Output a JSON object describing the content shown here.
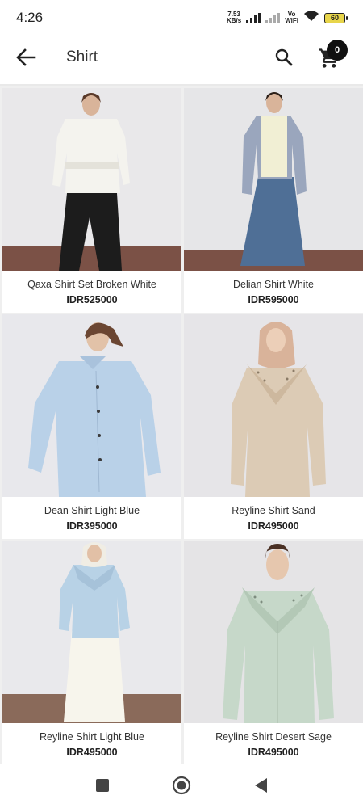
{
  "status_bar": {
    "time": "4:26",
    "net_speed_value": "7.53",
    "net_speed_unit": "KB/s",
    "vowifi_top": "Vo",
    "vowifi_bottom": "WiFi",
    "battery": "60"
  },
  "app_bar": {
    "title": "Shirt",
    "cart_count": "0",
    "back_icon": "arrow-left-icon",
    "search_icon": "search-icon",
    "cart_icon": "cart-icon"
  },
  "products": [
    {
      "name": "Qaxa Shirt Set Broken White",
      "price": "IDR525000"
    },
    {
      "name": "Delian Shirt White",
      "price": "IDR595000"
    },
    {
      "name": "Dean Shirt Light Blue",
      "price": "IDR395000"
    },
    {
      "name": "Reyline Shirt Sand",
      "price": "IDR495000"
    },
    {
      "name": "Reyline Shirt Light Blue",
      "price": "IDR495000"
    },
    {
      "name": "Reyline Shirt Desert Sage",
      "price": "IDR495000"
    }
  ],
  "nav": {
    "recents_icon": "square-icon",
    "home_icon": "circle-home-icon",
    "back_icon": "triangle-back-icon"
  },
  "colors": {
    "accent": "#111111",
    "grid_background": "#efefef"
  }
}
